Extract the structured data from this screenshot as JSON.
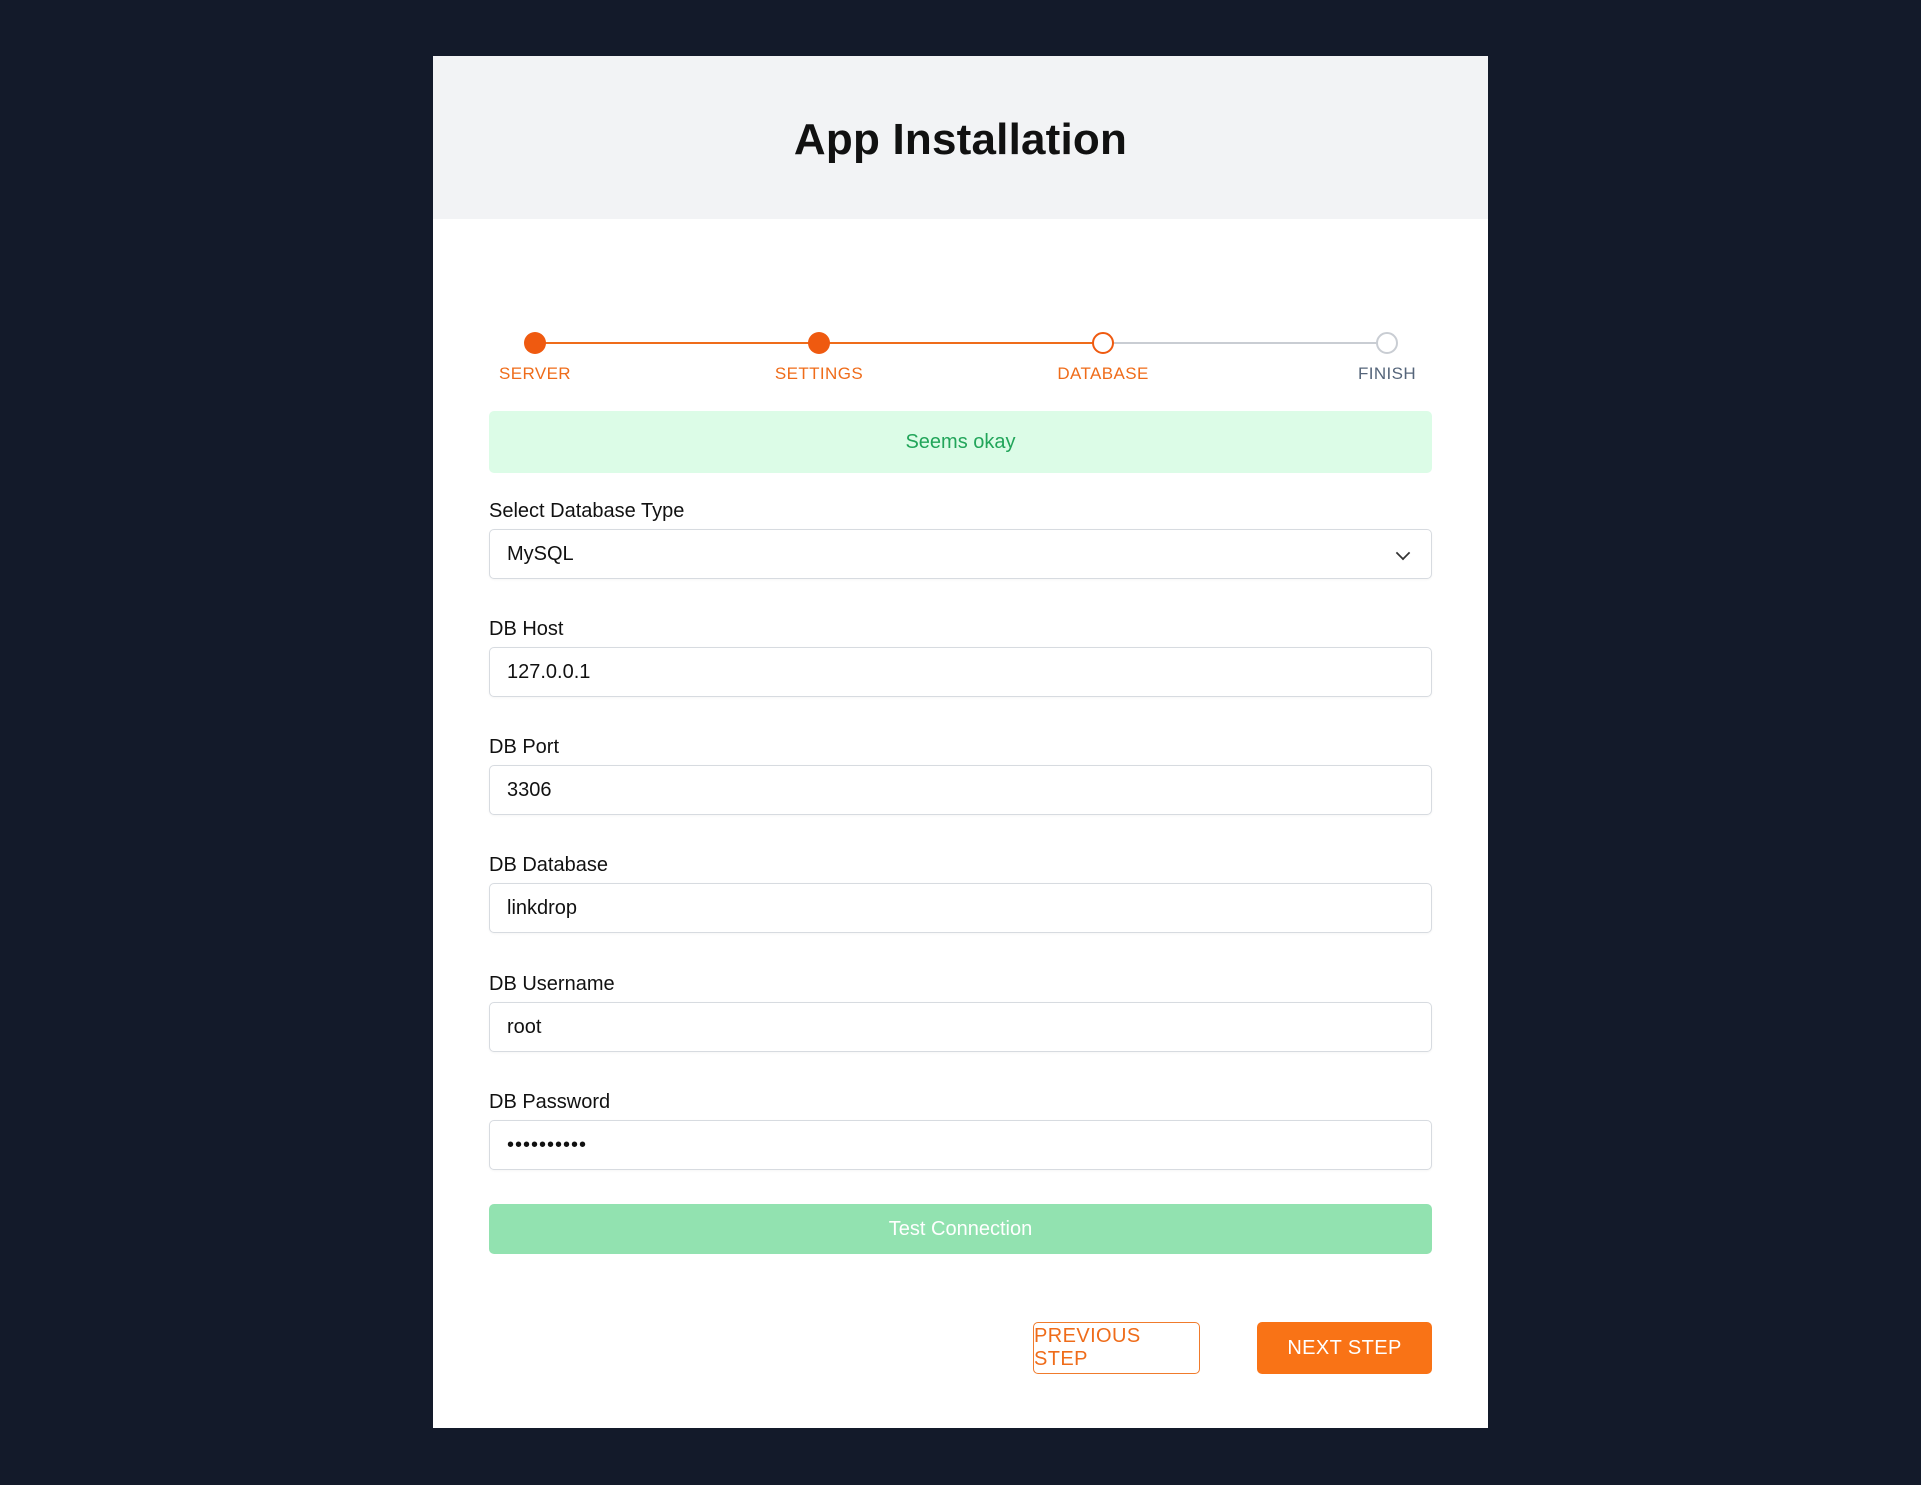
{
  "header": {
    "title": "App Installation"
  },
  "stepper": {
    "steps": [
      {
        "label": "SERVER",
        "state": "completed"
      },
      {
        "label": "SETTINGS",
        "state": "completed"
      },
      {
        "label": "DATABASE",
        "state": "current"
      },
      {
        "label": "FINISH",
        "state": "upcoming"
      }
    ]
  },
  "alert": {
    "message": "Seems okay"
  },
  "form": {
    "db_type": {
      "label": "Select Database Type",
      "value": "MySQL"
    },
    "db_host": {
      "label": "DB Host",
      "value": "127.0.0.1"
    },
    "db_port": {
      "label": "DB Port",
      "value": "3306"
    },
    "db_database": {
      "label": "DB Database",
      "value": "linkdrop"
    },
    "db_username": {
      "label": "DB Username",
      "value": "root"
    },
    "db_password": {
      "label": "DB Password",
      "value": "••••••••••"
    }
  },
  "buttons": {
    "test_connection": "Test Connection",
    "previous": "PREVIOUS STEP",
    "next": "NEXT STEP"
  },
  "colors": {
    "page_background": "#131a2a",
    "accent": "#f97316",
    "success_bg": "#dcfce7",
    "success_text": "#22a55a",
    "test_button_bg": "#92e2b0",
    "inactive_step": "#c9cdd3"
  }
}
